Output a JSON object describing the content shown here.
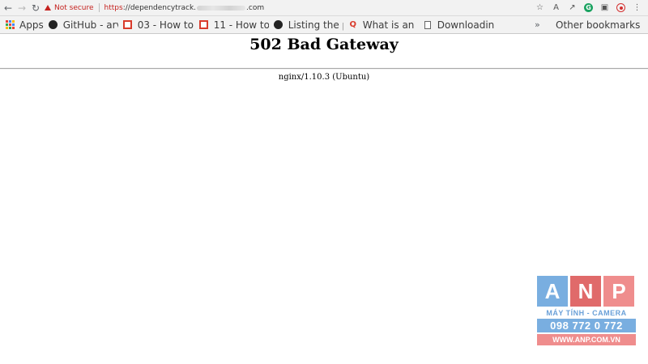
{
  "browser": {
    "security_label": "Not secure",
    "url_protocol": "https",
    "url_host_start": "://dependencytrack.",
    "url_host_end": ".com"
  },
  "bookmarks": {
    "apps": "Apps",
    "items": [
      {
        "label": "GitHub - arv",
        "icon": "github-icon"
      },
      {
        "label": "03 - How to",
        "icon": "red-square-icon"
      },
      {
        "label": "11 - How to",
        "icon": "red-square-icon"
      },
      {
        "label": "Listing the p",
        "icon": "github-icon"
      },
      {
        "label": "What is an a",
        "icon": "q-icon"
      },
      {
        "label": "Downloadin",
        "icon": "page-icon"
      }
    ],
    "overflow": "»",
    "other": "Other bookmarks"
  },
  "page": {
    "title": "502 Bad Gateway",
    "server": "nginx/1.10.3 (Ubuntu)"
  },
  "watermark": {
    "letters": [
      "A",
      "N",
      "P"
    ],
    "tagline": "MÁY TÍNH - CAMERA",
    "phone": "098 772 0 772",
    "website": "WWW.ANP.COM.VN"
  }
}
